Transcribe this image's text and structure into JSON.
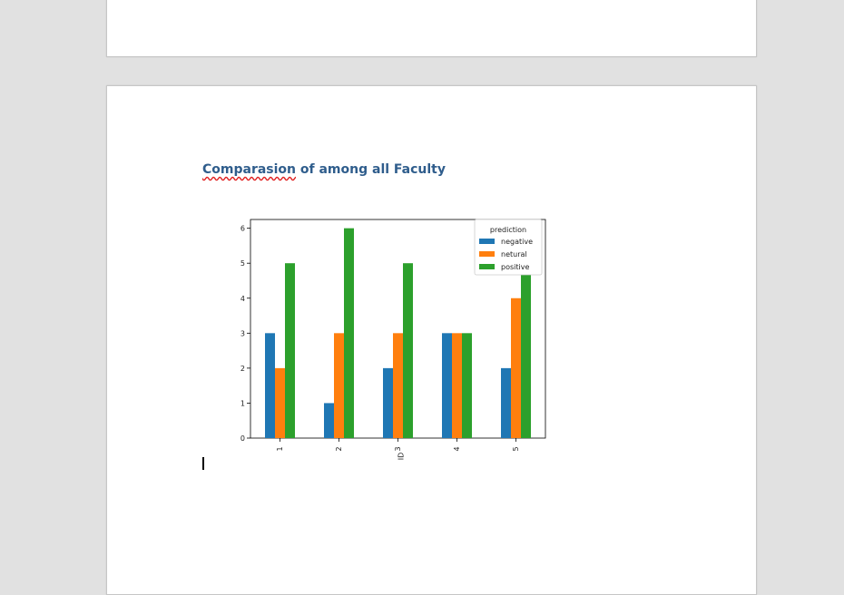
{
  "document": {
    "heading": {
      "misspelled_word": "Comparasion",
      "rest": " of among all Faculty"
    }
  },
  "chart_data": {
    "type": "bar",
    "categories": [
      "1",
      "2",
      "3",
      "4",
      "5"
    ],
    "xlabel": "ID",
    "ylabel": "",
    "ylim": [
      0,
      6.25
    ],
    "yticks": [
      0,
      1,
      2,
      3,
      4,
      5,
      6
    ],
    "grid": false,
    "legend": {
      "title": "prediction",
      "placement": "top-right"
    },
    "series": [
      {
        "name": "negative",
        "color": "#1f77b4",
        "values": [
          3,
          1,
          2,
          3,
          2
        ]
      },
      {
        "name": "netural",
        "color": "#ff7f0e",
        "values": [
          2,
          3,
          3,
          3,
          4
        ]
      },
      {
        "name": "positive",
        "color": "#2ca02c",
        "values": [
          5,
          6,
          5,
          3,
          5
        ]
      }
    ]
  }
}
